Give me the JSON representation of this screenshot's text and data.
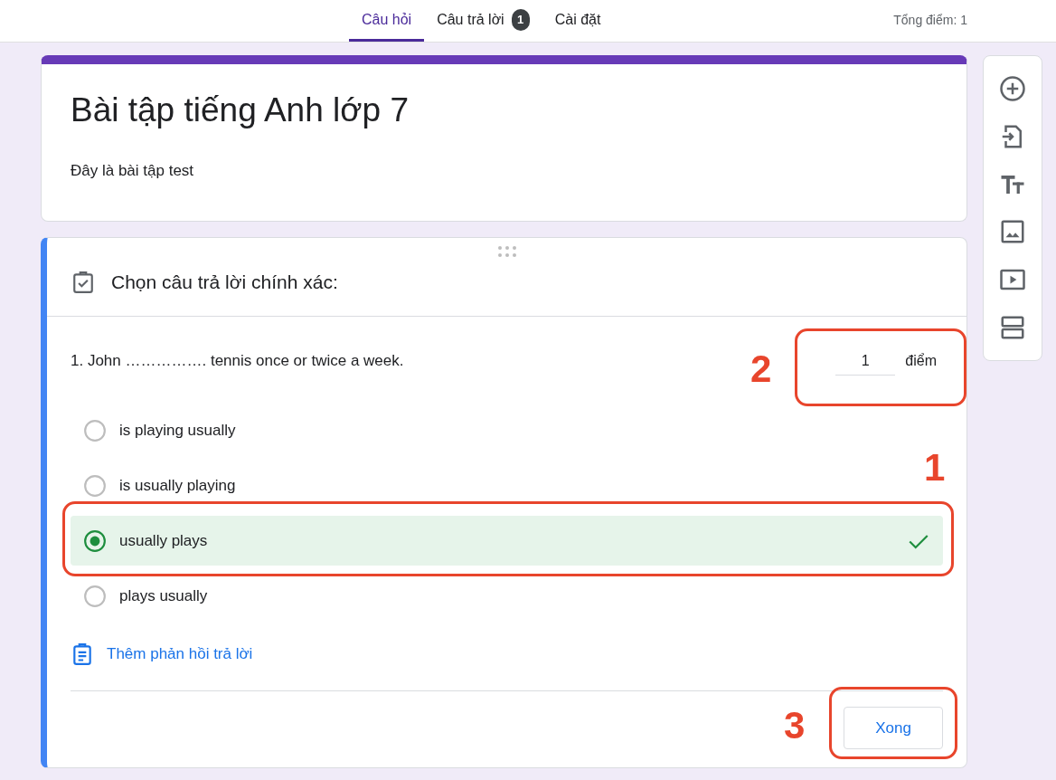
{
  "tabs": [
    {
      "label": "Câu hỏi",
      "selected": true
    },
    {
      "label": "Câu trả lời",
      "badge": "1",
      "selected": false
    },
    {
      "label": "Cài đặt",
      "selected": false
    }
  ],
  "total_points": "Tổng điểm: 1",
  "form": {
    "title": "Bài tập tiếng Anh lớp 7",
    "description": "Đây là bài tập test"
  },
  "question_card": {
    "section_title": "Chọn câu trả lời chính xác:",
    "question": "1. John ……………. tennis once or twice a week.",
    "points": {
      "value": "1",
      "unit": "điểm"
    },
    "options": [
      {
        "label": "is playing usually",
        "selected": false,
        "correct": false
      },
      {
        "label": "is usually playing",
        "selected": false,
        "correct": false
      },
      {
        "label": "usually plays",
        "selected": true,
        "correct": true
      },
      {
        "label": "plays usually",
        "selected": false,
        "correct": false
      }
    ],
    "feedback_link": "Thêm phản hồi trả lời",
    "done_button": "Xong"
  },
  "annotations": [
    {
      "label": "2",
      "kind": "points"
    },
    {
      "label": "1",
      "kind": "answer"
    },
    {
      "label": "3",
      "kind": "done"
    }
  ]
}
